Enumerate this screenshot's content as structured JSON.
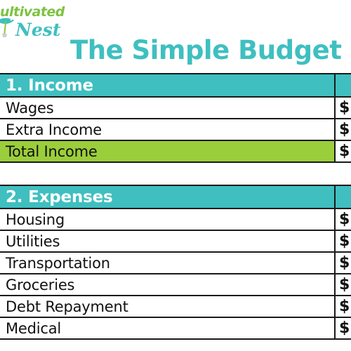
{
  "branding": {
    "logo": {
      "name": "cultivated-nest-logo",
      "word_top": "ultivated",
      "word_bottom": "Nest",
      "top_color": "#7DC242",
      "bottom_color": "#3FBFC0",
      "note_cropped": "left edge of logo cut off"
    }
  },
  "header": {
    "title": "The Simple Budget",
    "title_color": "#3FBFC0"
  },
  "colors": {
    "teal": "#3FBFC0",
    "green": "#9BCE3B",
    "border": "#1a1a1a",
    "text": "#111111",
    "header_text": "#ffffff",
    "background": "#ffffff"
  },
  "table": {
    "currency_symbol": "$",
    "sections": [
      {
        "header": "1. Income",
        "header_style": "teal",
        "rows": [
          {
            "label": "Wages",
            "amount": "$",
            "style": "plain"
          },
          {
            "label": "Extra Income",
            "amount": "$",
            "style": "plain"
          },
          {
            "label": "Total Income",
            "amount": "$",
            "style": "total"
          }
        ]
      },
      {
        "header": "2. Expenses",
        "header_style": "teal",
        "rows": [
          {
            "label": "Housing",
            "amount": "$",
            "style": "plain"
          },
          {
            "label": "Utilities",
            "amount": "$",
            "style": "plain"
          },
          {
            "label": "Transportation",
            "amount": "$",
            "style": "plain"
          },
          {
            "label": "Groceries",
            "amount": "$",
            "style": "plain"
          },
          {
            "label": "Debt Repayment",
            "amount": "$",
            "style": "plain"
          },
          {
            "label": "Medical",
            "amount": "$",
            "style": "plain"
          }
        ]
      }
    ]
  }
}
